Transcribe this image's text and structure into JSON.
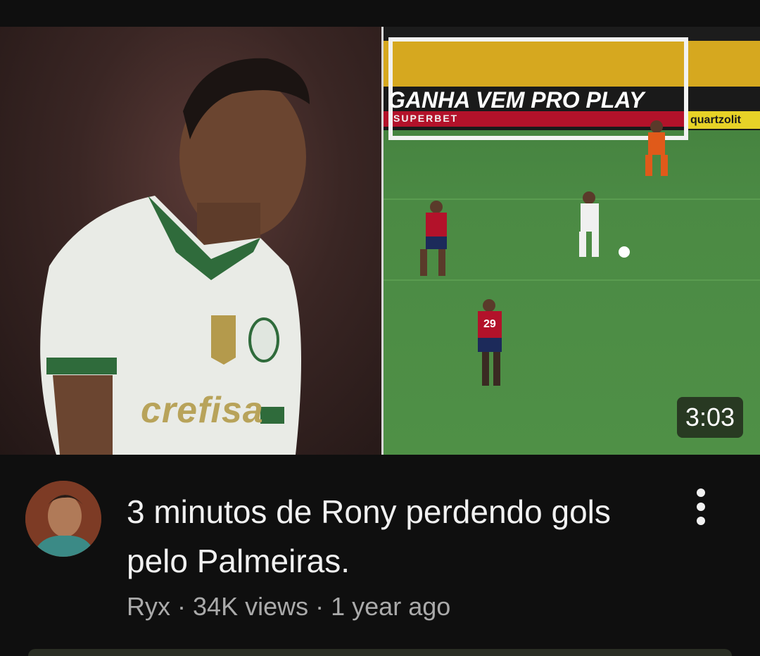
{
  "video": {
    "duration": "3:03",
    "title": "3 minutos de Rony perdendo gols pelo Palmeiras.",
    "channel": "Ryx",
    "separator": "·",
    "views": "34K views",
    "age": "1 year ago",
    "thumbnail_texts": {
      "jersey_sponsor": "crefisa",
      "board_text": "GANHA VEM PRO PLAY",
      "board_sponsor": "SUPERBET",
      "side_board": "quartzolit",
      "player_number": "29"
    }
  },
  "icons": {
    "more": "more-vert-icon"
  },
  "colors": {
    "background": "#0f0f0f",
    "title": "#f1f1f1",
    "subtitle": "#aaaaaa",
    "badge_bg": "#232d1e"
  }
}
